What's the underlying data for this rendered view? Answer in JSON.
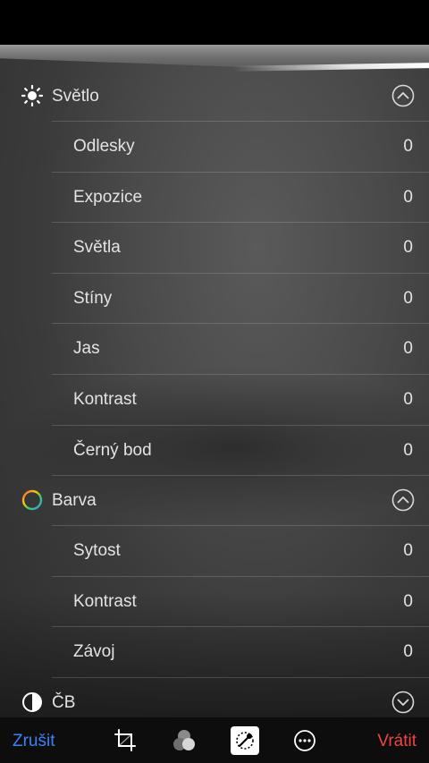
{
  "sections": [
    {
      "title": "Světlo",
      "icon": "sun-icon",
      "expanded": true,
      "rows": [
        {
          "label": "Odlesky",
          "value": "0"
        },
        {
          "label": "Expozice",
          "value": "0"
        },
        {
          "label": "Světla",
          "value": "0"
        },
        {
          "label": "Stíny",
          "value": "0"
        },
        {
          "label": "Jas",
          "value": "0"
        },
        {
          "label": "Kontrast",
          "value": "0"
        },
        {
          "label": "Černý bod",
          "value": "0"
        }
      ]
    },
    {
      "title": "Barva",
      "icon": "color-wheel-icon",
      "expanded": true,
      "rows": [
        {
          "label": "Sytost",
          "value": "0"
        },
        {
          "label": "Kontrast",
          "value": "0"
        },
        {
          "label": "Závoj",
          "value": "0"
        }
      ]
    },
    {
      "title": "ČB",
      "icon": "half-circle-icon",
      "expanded": false,
      "rows": []
    }
  ],
  "toolbar": {
    "cancel_label": "Zrušit",
    "revert_label": "Vrátit",
    "icons": [
      "crop-icon",
      "filters-icon",
      "adjust-icon",
      "more-icon"
    ],
    "active_icon": "adjust-icon"
  },
  "colors": {
    "cancel": "#3b82f6",
    "revert": "#ef4444",
    "text": "#e3e3e3"
  }
}
